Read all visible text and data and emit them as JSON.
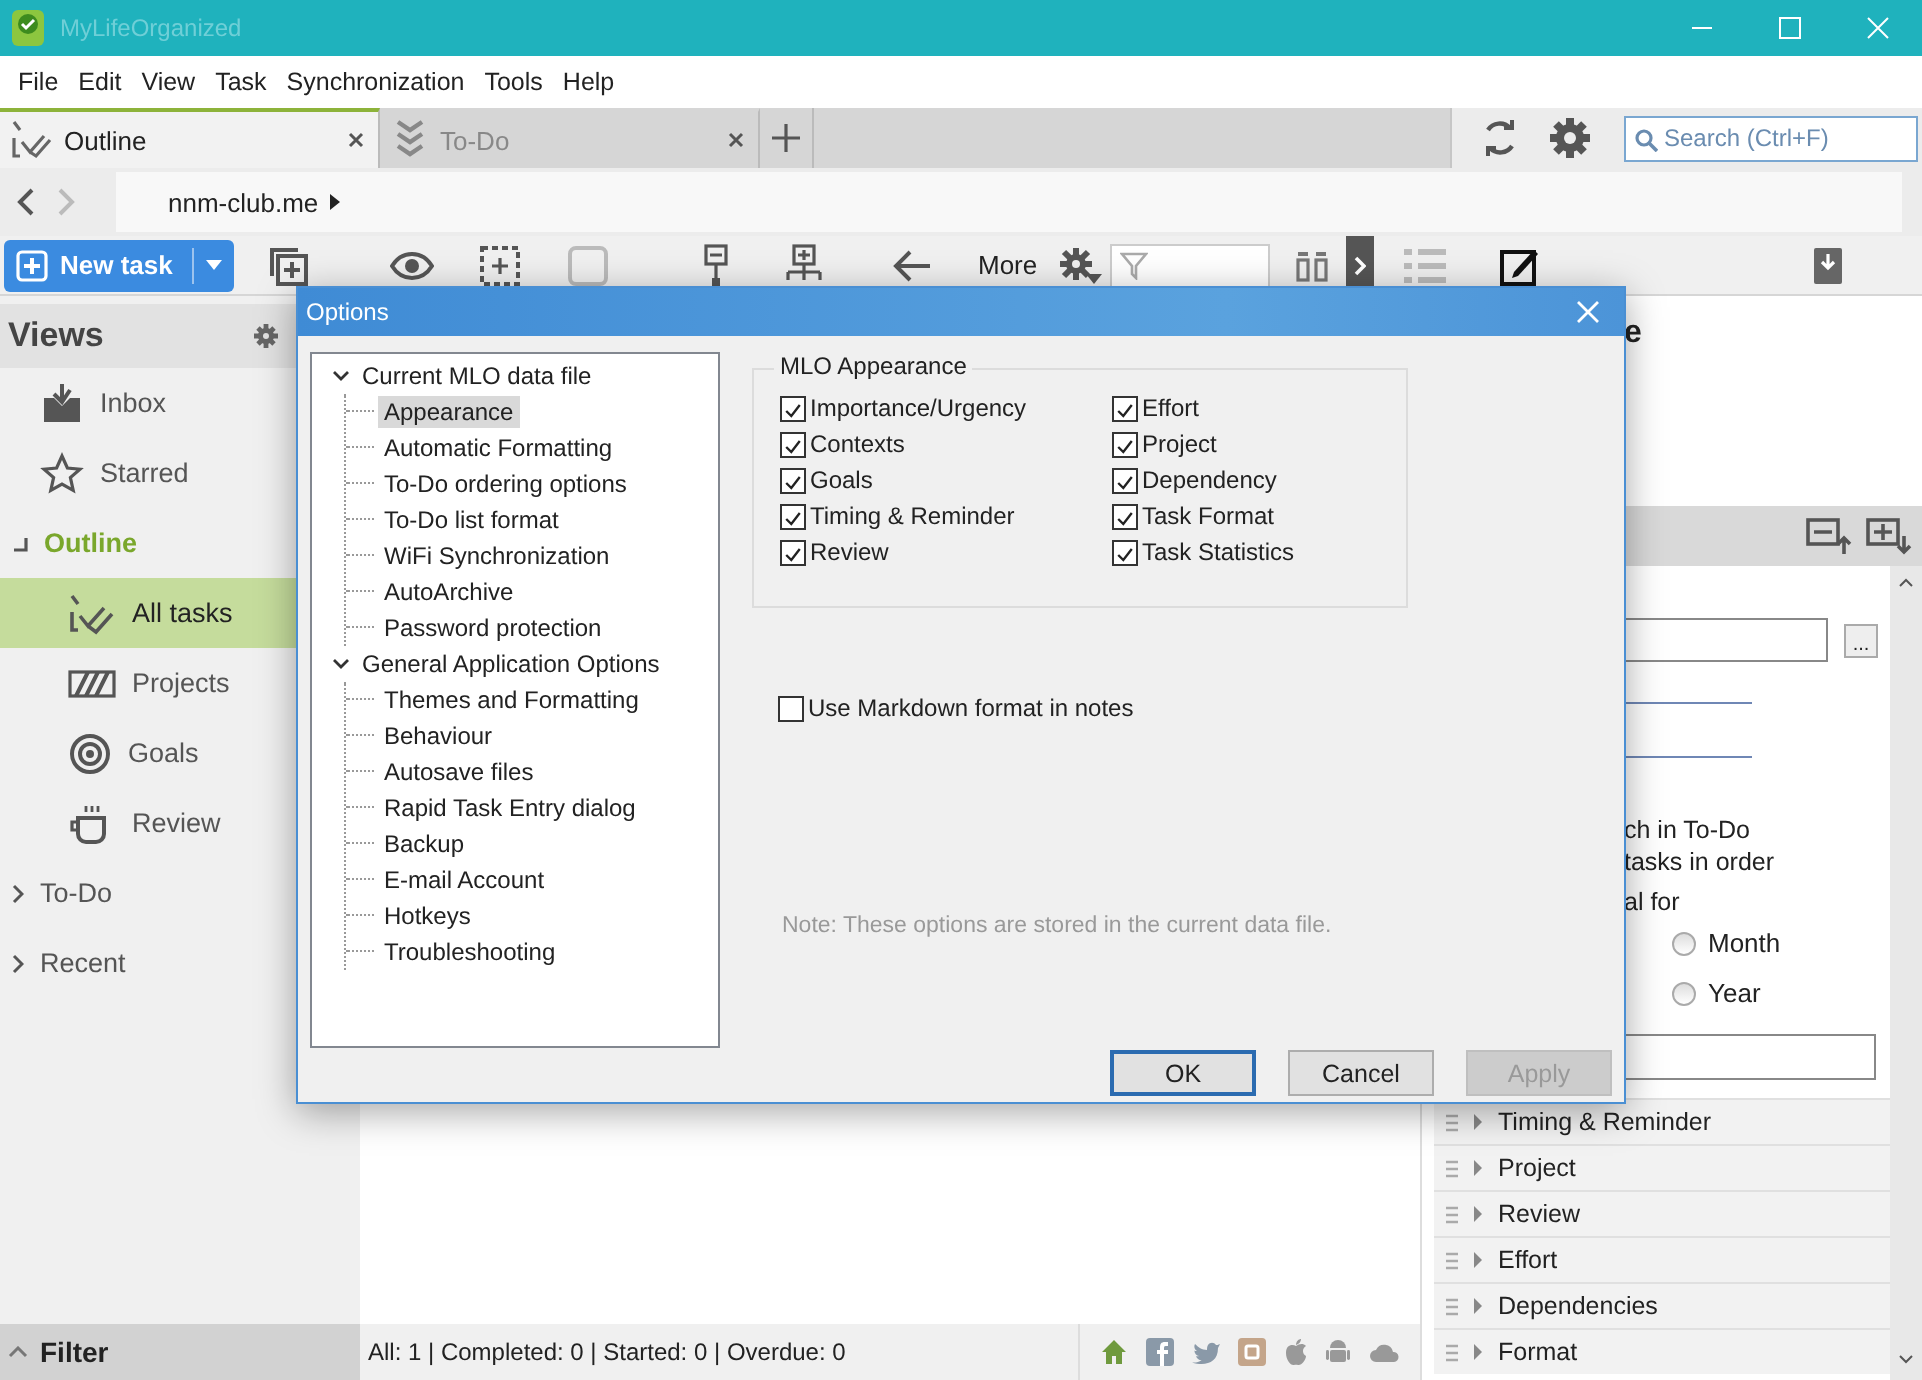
{
  "window": {
    "title": "MyLifeOrganized"
  },
  "menu": [
    "File",
    "Edit",
    "View",
    "Task",
    "Synchronization",
    "Tools",
    "Help"
  ],
  "tabs": [
    {
      "label": "Outline",
      "selected": true
    },
    {
      "label": "To-Do",
      "selected": false
    }
  ],
  "search": {
    "placeholder": "Search (Ctrl+F)"
  },
  "breadcrumb": {
    "label": "nnm-club.me"
  },
  "toolbar": {
    "new_task": "New task",
    "more": "More"
  },
  "sidebar": {
    "title": "Views",
    "items": [
      {
        "kind": "item",
        "label": "Inbox",
        "selected": false
      },
      {
        "kind": "item",
        "label": "Starred",
        "selected": false
      },
      {
        "kind": "group",
        "label": "Outline",
        "expanded": true,
        "children": [
          {
            "kind": "item",
            "label": "All tasks",
            "selected": true
          },
          {
            "kind": "item",
            "label": "Projects",
            "selected": false
          },
          {
            "kind": "item",
            "label": "Goals",
            "selected": false
          },
          {
            "kind": "item",
            "label": "Review",
            "selected": false
          }
        ]
      },
      {
        "kind": "group",
        "label": "To-Do",
        "expanded": false
      },
      {
        "kind": "group",
        "label": "Recent",
        "expanded": false
      }
    ],
    "filter": "Filter"
  },
  "status_bar": "All: 1 | Completed: 0 | Started: 0 | Overdue: 0",
  "right_panel": {
    "heading": "e",
    "browse_button": "...",
    "fragments": [
      "ch in To-Do",
      "tasks in order",
      "al for"
    ],
    "radios": [
      {
        "label": "Month",
        "selected": false
      },
      {
        "label": "Year",
        "selected": false
      }
    ],
    "sections": [
      {
        "label": "Timing & Reminder",
        "expanded": false
      },
      {
        "label": "Project",
        "expanded": false
      },
      {
        "label": "Review",
        "expanded": false
      },
      {
        "label": "Effort",
        "expanded": false
      },
      {
        "label": "Dependencies",
        "expanded": false
      },
      {
        "label": "Format",
        "expanded": false
      }
    ]
  },
  "dialog": {
    "title": "Options",
    "tree": [
      {
        "label": "Current MLO data file",
        "expanded": true,
        "children": [
          {
            "label": "Appearance",
            "selected": true
          },
          {
            "label": "Automatic Formatting",
            "selected": false
          },
          {
            "label": "To-Do ordering options",
            "selected": false
          },
          {
            "label": "To-Do list format",
            "selected": false
          },
          {
            "label": "WiFi Synchronization",
            "selected": false
          },
          {
            "label": "AutoArchive",
            "selected": false
          },
          {
            "label": "Password protection",
            "selected": false
          }
        ]
      },
      {
        "label": "General Application Options",
        "expanded": true,
        "children": [
          {
            "label": "Themes and Formatting",
            "selected": false
          },
          {
            "label": "Behaviour",
            "selected": false
          },
          {
            "label": "Autosave files",
            "selected": false
          },
          {
            "label": "Rapid Task Entry dialog",
            "selected": false
          },
          {
            "label": "Backup",
            "selected": false
          },
          {
            "label": "E-mail Account",
            "selected": false
          },
          {
            "label": "Hotkeys",
            "selected": false
          },
          {
            "label": "Troubleshooting",
            "selected": false
          }
        ]
      }
    ],
    "group": {
      "title": "MLO Appearance",
      "options": [
        {
          "label": "Importance/Urgency",
          "checked": true
        },
        {
          "label": "Contexts",
          "checked": true
        },
        {
          "label": "Goals",
          "checked": true
        },
        {
          "label": "Timing & Reminder",
          "checked": true
        },
        {
          "label": "Review",
          "checked": true
        },
        {
          "label": "Effort",
          "checked": true
        },
        {
          "label": "Project",
          "checked": true
        },
        {
          "label": "Dependency",
          "checked": true
        },
        {
          "label": "Task Format",
          "checked": true
        },
        {
          "label": "Task Statistics",
          "checked": true
        }
      ]
    },
    "markdown": {
      "label": "Use Markdown format in notes",
      "checked": false
    },
    "note": "Note: These options are stored in the current data file.",
    "buttons": [
      {
        "label": "OK",
        "kind": "default"
      },
      {
        "label": "Cancel",
        "kind": "normal"
      },
      {
        "label": "Apply",
        "kind": "disabled"
      }
    ]
  }
}
